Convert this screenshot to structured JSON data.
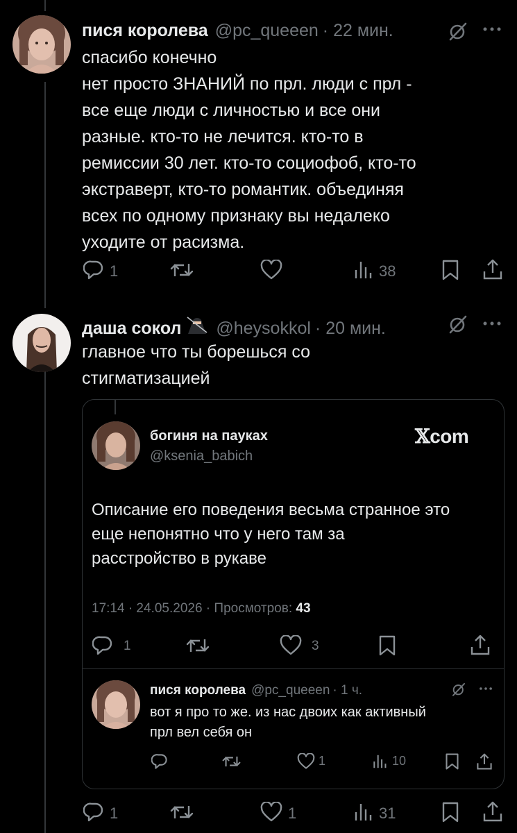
{
  "tweet1": {
    "name": "пися королева",
    "handle": "@pc_queeen",
    "time": "· 22 мин.",
    "lines": [
      "спасибо конечно",
      "нет просто ЗНАНИЙ по прл. люди с прл -",
      "все еще люди с личностью и все они",
      "разные. кто-то не лечится. кто-то в",
      "ремиссии 30 лет. кто-то социофоб, кто-то",
      "экстраверт, кто-то романтик. объединяя",
      "всех по одному признаку вы недалеко",
      "уходите от расизма."
    ],
    "replies": "1",
    "reposts": "",
    "likes": "",
    "views": "38"
  },
  "tweet2": {
    "name": "даша сокол",
    "emoji": "ninja-emoji",
    "handle": "@heysokkol",
    "time": "· 20 мин.",
    "lines": [
      "главное что ты борешься со",
      "стигматизацией"
    ],
    "replies": "1",
    "reposts": "",
    "likes": "1",
    "views": "31"
  },
  "quoted": {
    "name": "богиня на пауках",
    "handle": "@ksenia_babich",
    "source": "com",
    "lines": [
      "Описание его поведения весьма странное это",
      "еще непонятно что у него там за",
      "расстройство в рукаве"
    ],
    "timestamp": "17:14 · 24.05.2026 · Просмотров:",
    "view_count": "43",
    "replies": "1",
    "likes": "3"
  },
  "reply": {
    "name": "пися королева",
    "handle": "@pc_queeen",
    "time": "· 1 ч.",
    "lines": [
      "вот я про то же. из нас двоих как активный",
      "прл вел себя он"
    ],
    "likes": "1",
    "views": "10"
  },
  "colors": {
    "background": "#000000",
    "text": "#e7e9ea",
    "secondary": "#71767b",
    "border": "#2f3336"
  }
}
